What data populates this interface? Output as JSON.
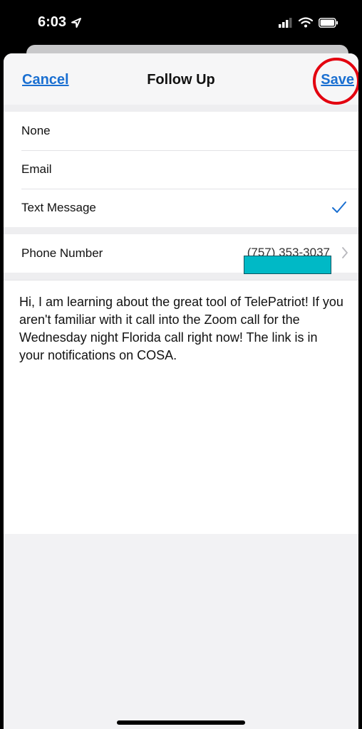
{
  "status_bar": {
    "time": "6:03",
    "location_icon": "location-arrow-icon",
    "signal_icon": "cell-signal-icon",
    "wifi_icon": "wifi-icon",
    "battery_icon": "battery-icon"
  },
  "nav": {
    "cancel_label": "Cancel",
    "title": "Follow Up",
    "save_label": "Save"
  },
  "follow_up_options": [
    {
      "label": "None",
      "selected": false
    },
    {
      "label": "Email",
      "selected": false
    },
    {
      "label": "Text Message",
      "selected": true
    }
  ],
  "phone": {
    "label": "Phone Number",
    "value": "(757) 353-3037"
  },
  "message": {
    "text": "Hi, I am learning about the great tool of TelePatriot!  If you aren't familiar with it call into the Zoom call for the Wednesday night Florida call right now!  The link is in your notifications on COSA."
  },
  "colors": {
    "accent": "#1a6fd1",
    "highlight_circle": "#e3000f",
    "redaction": "#00b9c6"
  }
}
